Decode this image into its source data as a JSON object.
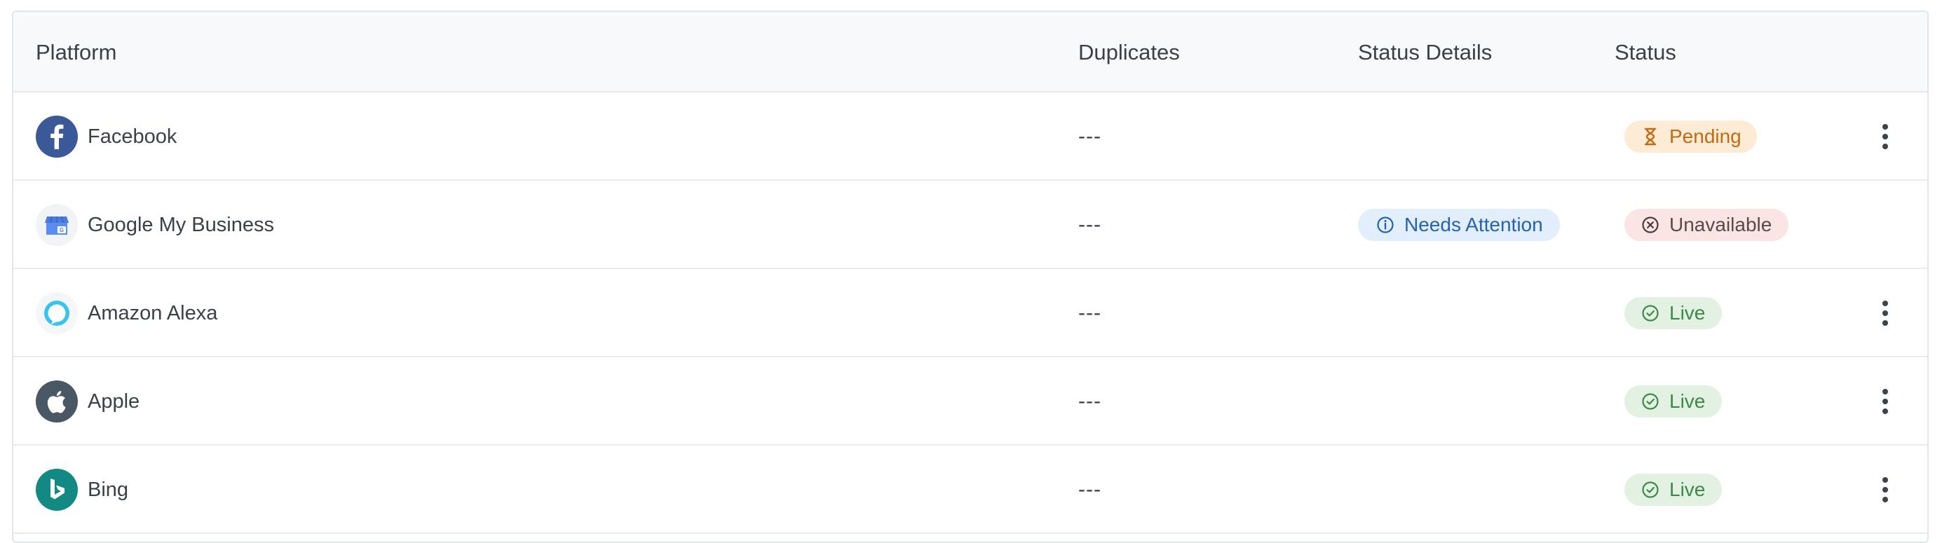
{
  "columns": {
    "platform": "Platform",
    "duplicates": "Duplicates",
    "status_details": "Status Details",
    "status": "Status"
  },
  "rows": [
    {
      "platform": "Facebook",
      "logo_icon": "facebook-icon",
      "duplicates": "---",
      "status_details": "",
      "status": "Pending",
      "status_icon": "hourglass-icon",
      "has_menu": true
    },
    {
      "platform": "Google My Business",
      "logo_icon": "google-my-business-icon",
      "duplicates": "---",
      "status_details": "Needs Attention",
      "status_details_icon": "info-icon",
      "status": "Unavailable",
      "status_icon": "x-circle-icon",
      "has_menu": false
    },
    {
      "platform": "Amazon Alexa",
      "logo_icon": "amazon-alexa-icon",
      "duplicates": "---",
      "status_details": "",
      "status": "Live",
      "status_icon": "check-circle-icon",
      "has_menu": true
    },
    {
      "platform": "Apple",
      "logo_icon": "apple-icon",
      "duplicates": "---",
      "status_details": "",
      "status": "Live",
      "status_icon": "check-circle-icon",
      "has_menu": true
    },
    {
      "platform": "Bing",
      "logo_icon": "bing-icon",
      "duplicates": "---",
      "status_details": "",
      "status": "Live",
      "status_icon": "check-circle-icon",
      "has_menu": true
    }
  ],
  "colors": {
    "pending": "#c46a10",
    "unavailable": "#5a4a4c",
    "live": "#3b8a45",
    "attention": "#2463b0",
    "facebook": "#3b5998",
    "apple": "#4a5866",
    "bing": "#128a83"
  }
}
